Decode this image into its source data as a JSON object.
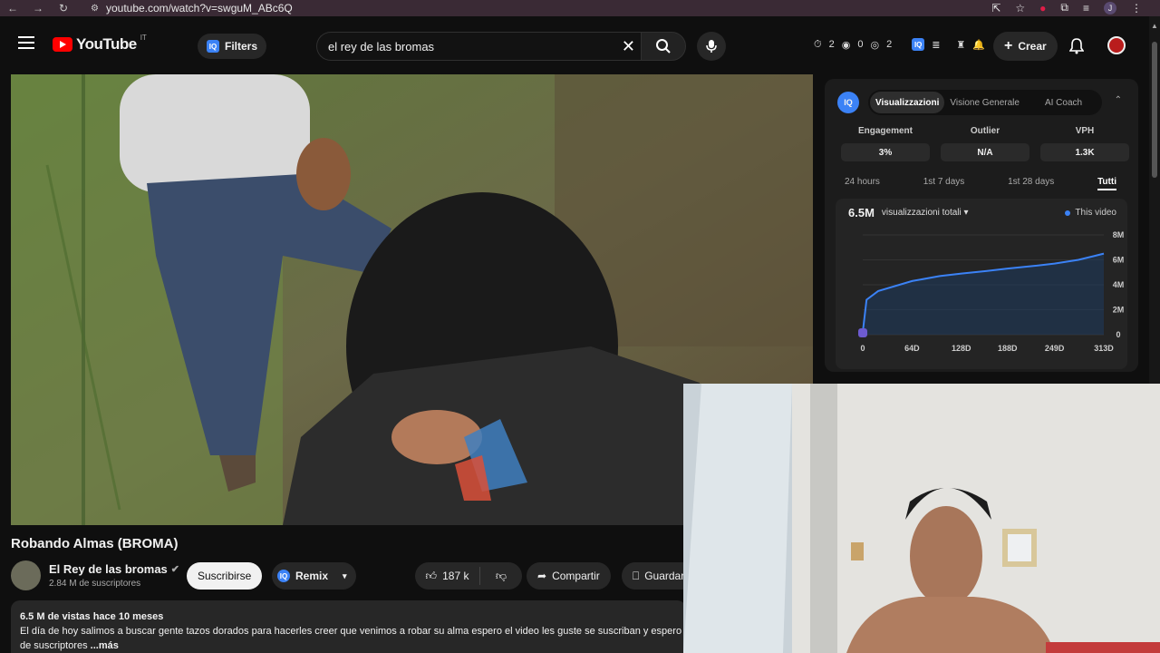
{
  "browser": {
    "url": "youtube.com/watch?v=swguM_ABc6Q",
    "profile_initial": "J"
  },
  "header": {
    "logo_text": "YouTube",
    "country_code": "IT",
    "filters_label": "Filters",
    "search_value": "el rey de las bromas",
    "stats": [
      "2",
      "0",
      "2"
    ],
    "create_label": "Crear"
  },
  "video": {
    "title": "Robando Almas (BROMA)",
    "channel_name": "El Rey de las bromas",
    "subscribers": "2.84 M de suscriptores",
    "subscribe_label": "Suscribirse",
    "remix_label": "Remix",
    "likes": "187 k",
    "share_label": "Compartir",
    "save_label": "Guardar",
    "views_meta": "6.5 M de vistas  hace 10 meses",
    "description": "El día de hoy salimos a buscar gente tazos dorados para hacerles creer que venimos a robar su alma espero el video les guste se suscriban y espero",
    "description_line2": "de suscriptores ",
    "more_label": "...más"
  },
  "analytics": {
    "tabs": [
      "Visualizzazioni",
      "Visione Generale",
      "AI Coach"
    ],
    "metrics": [
      {
        "label": "Engagement",
        "value": "3%"
      },
      {
        "label": "Outlier",
        "value": "N/A"
      },
      {
        "label": "VPH",
        "value": "1.3K"
      }
    ],
    "ranges": [
      "24 hours",
      "1st 7 days",
      "1st 28 days",
      "Tutti"
    ],
    "total": "6.5M",
    "metric_select": "visualizzazioni totali",
    "legend": "This video"
  },
  "chart_data": {
    "type": "area",
    "x": [
      0,
      5,
      20,
      64,
      100,
      128,
      160,
      188,
      220,
      249,
      280,
      300,
      313
    ],
    "values": [
      0.2,
      2.8,
      3.5,
      4.3,
      4.7,
      4.9,
      5.1,
      5.3,
      5.5,
      5.7,
      6.0,
      6.3,
      6.5
    ],
    "xticks": [
      "0",
      "64D",
      "128D",
      "188D",
      "249D",
      "313D"
    ],
    "yticks": [
      "0",
      "2M",
      "4M",
      "6M",
      "8M"
    ],
    "ylim": [
      0,
      8
    ],
    "series_name": "This video",
    "color": "#3b82f6"
  }
}
